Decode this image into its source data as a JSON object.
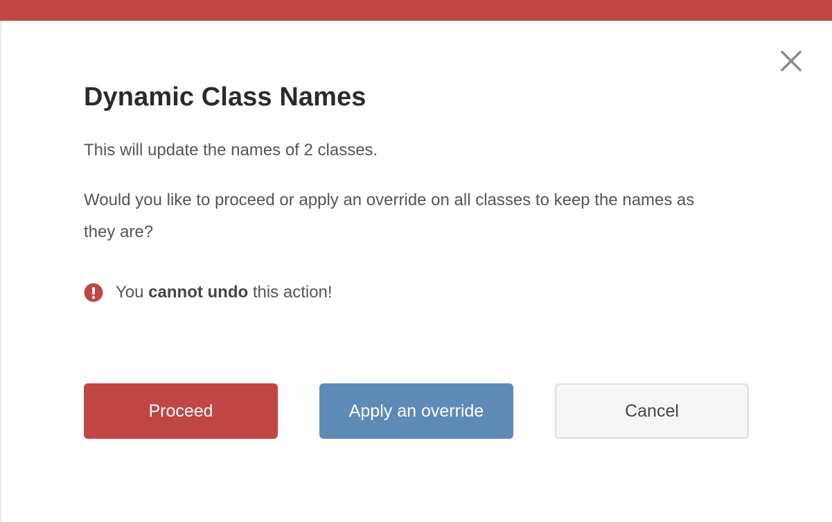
{
  "colors": {
    "accent_red": "#c04644",
    "accent_blue": "#5e8ab8",
    "cancel_bg": "#f6f6f6"
  },
  "icons": {
    "close": "close-icon",
    "warning": "exclamation-circle-icon"
  },
  "dialog": {
    "title": "Dynamic Class Names",
    "message": "This will update the names of 2 classes.",
    "question": "Would you like to proceed or apply an override on all classes to keep the names as they are?",
    "warning": {
      "prefix": "You ",
      "emphasis": "cannot undo",
      "suffix": " this action!"
    }
  },
  "buttons": {
    "proceed": "Proceed",
    "override": "Apply an override",
    "cancel": "Cancel"
  }
}
